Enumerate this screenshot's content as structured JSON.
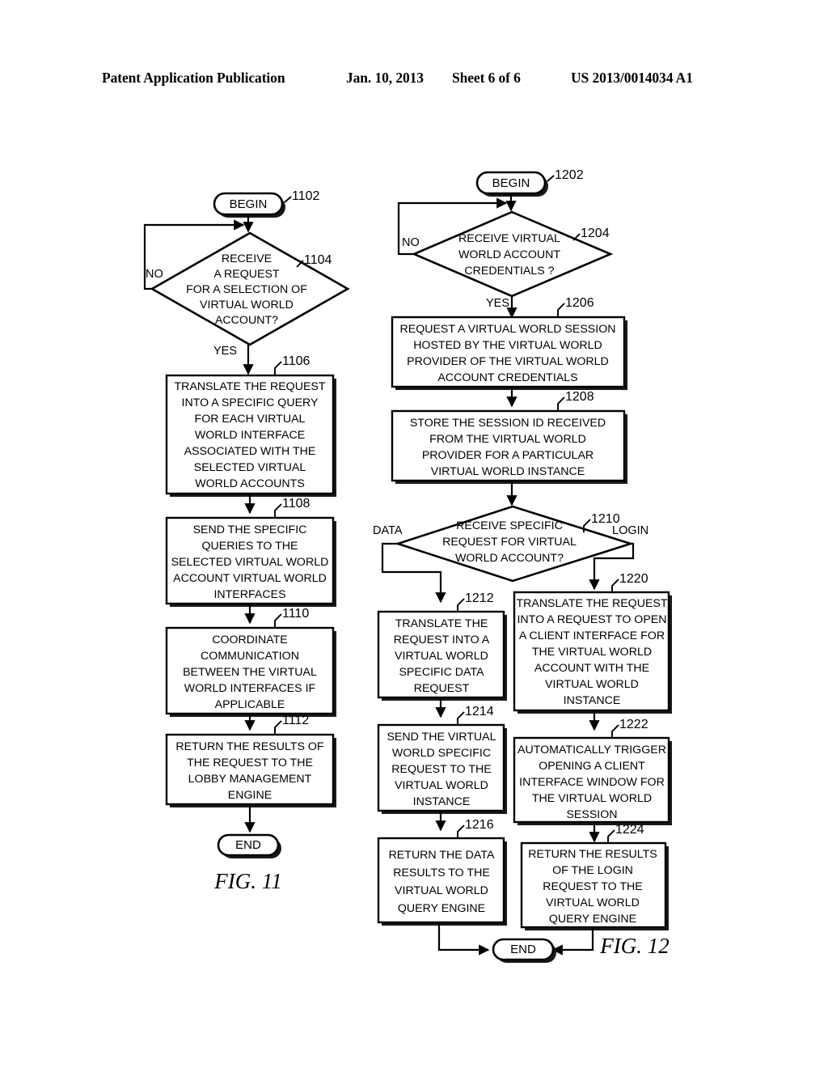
{
  "header": {
    "publication": "Patent Application Publication",
    "date": "Jan. 10, 2013",
    "sheet": "Sheet 6 of 6",
    "patent_number": "US 2013/0014034 A1"
  },
  "fig11": {
    "label": "FIG. 11",
    "begin": {
      "ref": "1102",
      "text": "BEGIN"
    },
    "decision": {
      "ref": "1104",
      "lines": [
        "RECEIVE",
        "A REQUEST",
        "FOR A SELECTION OF",
        "VIRTUAL WORLD",
        "ACCOUNT?"
      ],
      "no_label": "NO",
      "yes_label": "YES"
    },
    "steps": [
      {
        "ref": "1106",
        "lines": [
          "TRANSLATE THE REQUEST",
          "INTO A SPECIFIC QUERY",
          "FOR EACH  VIRTUAL",
          "WORLD INTERFACE",
          "ASSOCIATED WITH THE",
          "SELECTED VIRTUAL",
          "WORLD ACCOUNTS"
        ]
      },
      {
        "ref": "1108",
        "lines": [
          "SEND THE SPECIFIC",
          "QUERIES TO THE",
          "SELECTED VIRTUAL WORLD",
          "ACCOUNT VIRTUAL WORLD",
          "INTERFACES"
        ]
      },
      {
        "ref": "1110",
        "lines": [
          "COORDINATE",
          "COMMUNICATION",
          "BETWEEN THE VIRTUAL",
          "WORLD INTERFACES IF",
          "APPLICABLE"
        ]
      },
      {
        "ref": "1112",
        "lines": [
          "RETURN THE RESULTS OF",
          "THE REQUEST  TO THE",
          "LOBBY MANAGEMENT",
          "ENGINE"
        ]
      }
    ],
    "end": {
      "text": "END"
    }
  },
  "fig12": {
    "label": "FIG. 12",
    "begin": {
      "ref": "1202",
      "text": "BEGIN"
    },
    "decision1": {
      "ref": "1204",
      "lines": [
        "RECEIVE VIRTUAL",
        "WORLD ACCOUNT",
        "CREDENTIALS ?"
      ],
      "no_label": "NO",
      "yes_label": "YES"
    },
    "step1206": {
      "ref": "1206",
      "lines": [
        "REQUEST A VIRTUAL WORLD SESSION",
        "HOSTED BY THE VIRTUAL WORLD",
        "PROVIDER OF THE VIRTUAL WORLD",
        "ACCOUNT CREDENTIALS"
      ]
    },
    "step1208": {
      "ref": "1208",
      "lines": [
        "STORE THE SESSION ID RECEIVED",
        "FROM THE VIRTUAL WORLD",
        "PROVIDER FOR A PARTICULAR",
        "VIRTUAL WORLD INSTANCE"
      ]
    },
    "decision2": {
      "ref": "1210",
      "lines": [
        "RECEIVE SPECIFIC",
        "REQUEST FOR VIRTUAL",
        "WORLD ACCOUNT?"
      ],
      "left_label": "DATA",
      "right_label": "LOGIN"
    },
    "data_branch": [
      {
        "ref": "1212",
        "lines": [
          "TRANSLATE THE",
          "REQUEST INTO A",
          "VIRTUAL WORLD",
          "SPECIFIC DATA",
          "REQUEST"
        ]
      },
      {
        "ref": "1214",
        "lines": [
          "SEND THE VIRTUAL",
          "WORLD SPECIFIC",
          "REQUEST TO THE",
          "VIRTUAL WORLD",
          "INSTANCE"
        ]
      },
      {
        "ref": "1216",
        "lines": [
          "RETURN THE DATA",
          "RESULTS TO THE",
          "VIRTUAL WORLD",
          "QUERY ENGINE"
        ]
      }
    ],
    "login_branch": [
      {
        "ref": "1220",
        "lines": [
          "TRANSLATE THE REQUEST",
          "INTO A REQUEST TO OPEN",
          "A CLIENT INTERFACE FOR",
          "THE VIRTUAL WORLD",
          "ACCOUNT WITH THE",
          "VIRTUAL WORLD",
          "INSTANCE"
        ]
      },
      {
        "ref": "1222",
        "lines": [
          "AUTOMATICALLY TRIGGER",
          "OPENING A CLIENT",
          "INTERFACE WINDOW FOR",
          "THE VIRTUAL WORLD",
          "SESSION"
        ]
      },
      {
        "ref": "1224",
        "lines": [
          "RETURN THE RESULTS",
          "OF THE LOGIN",
          "REQUEST TO THE",
          "VIRTUAL WORLD",
          "QUERY ENGINE"
        ]
      }
    ],
    "end": {
      "text": "END"
    }
  }
}
